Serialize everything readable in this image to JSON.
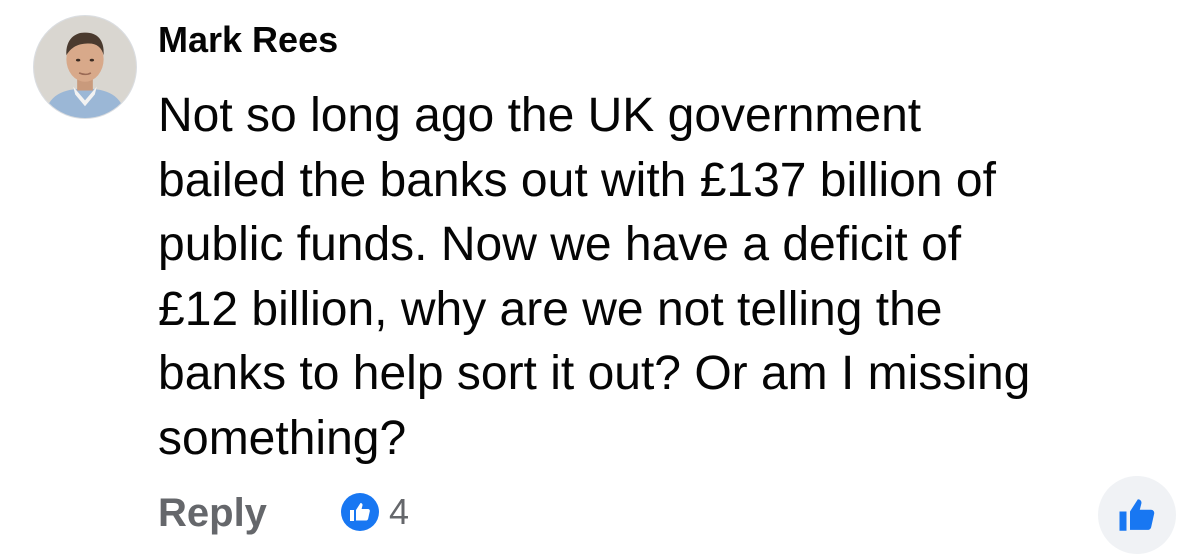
{
  "comment": {
    "author": "Mark Rees",
    "text_lines": [
      "Not so long ago the UK government",
      "bailed the banks out with £137 billion of",
      "public funds. Now we have a deficit of",
      "£12 billion, why are we not telling the",
      "banks to help sort it out? Or am I missing",
      "something?"
    ],
    "avatar_icon": "profile-photo",
    "actions": {
      "reply_label": "Reply",
      "reaction_icon": "thumbs-up-icon",
      "reaction_count": "4",
      "like_icon": "thumbs-up-icon"
    }
  },
  "colors": {
    "text": "#050505",
    "secondary_text": "#65676b",
    "accent": "#1877f2",
    "button_bg": "#f0f2f5"
  }
}
